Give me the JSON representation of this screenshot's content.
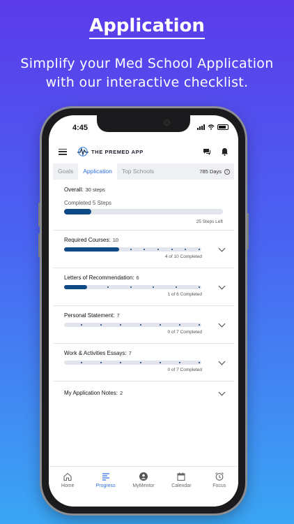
{
  "promo": {
    "title": "Application",
    "subtitle_line1": "Simplify your Med School Application",
    "subtitle_line2": "with our interactive checklist."
  },
  "status_bar": {
    "time": "4:45"
  },
  "app": {
    "logo_text": "THE PREMED APP"
  },
  "tabs": [
    {
      "label": "Goals",
      "active": false
    },
    {
      "label": "Application",
      "active": true
    },
    {
      "label": "Top Schools",
      "active": false
    }
  ],
  "days_remaining": "785 Days",
  "overall": {
    "label": "Overall:",
    "steps": "30 steps",
    "completed": "Completed 5 Steps",
    "progress": 0.17,
    "steps_left": "25 Steps Left"
  },
  "sections": [
    {
      "label": "Required Courses:",
      "count": "10",
      "total": 10,
      "done": 4,
      "status": "4 of 10 Completed"
    },
    {
      "label": "Letters of Recommendation:",
      "count": "6",
      "total": 6,
      "done": 1,
      "status": "1 of 6 Completed"
    },
    {
      "label": "Personal Statement:",
      "count": "7",
      "total": 7,
      "done": 0,
      "status": "0 of 7 Completed"
    },
    {
      "label": "Work & Activities Essays:",
      "count": "7",
      "total": 7,
      "done": 0,
      "status": "0 of 7 Completed"
    }
  ],
  "notes": {
    "label": "My Application Notes:",
    "count": "2"
  },
  "bottom_nav": [
    {
      "label": "Home",
      "icon": "home-icon",
      "active": false
    },
    {
      "label": "Progress",
      "icon": "progress-icon",
      "active": true
    },
    {
      "label": "MyMentor",
      "icon": "mentor-icon",
      "active": false
    },
    {
      "label": "Calendar",
      "icon": "calendar-icon",
      "active": false
    },
    {
      "label": "Focus",
      "icon": "alarm-clock-icon",
      "active": false
    }
  ],
  "colors": {
    "accent": "#2d6fe0",
    "progress": "#0f4a86",
    "track": "#e2e6ec"
  }
}
